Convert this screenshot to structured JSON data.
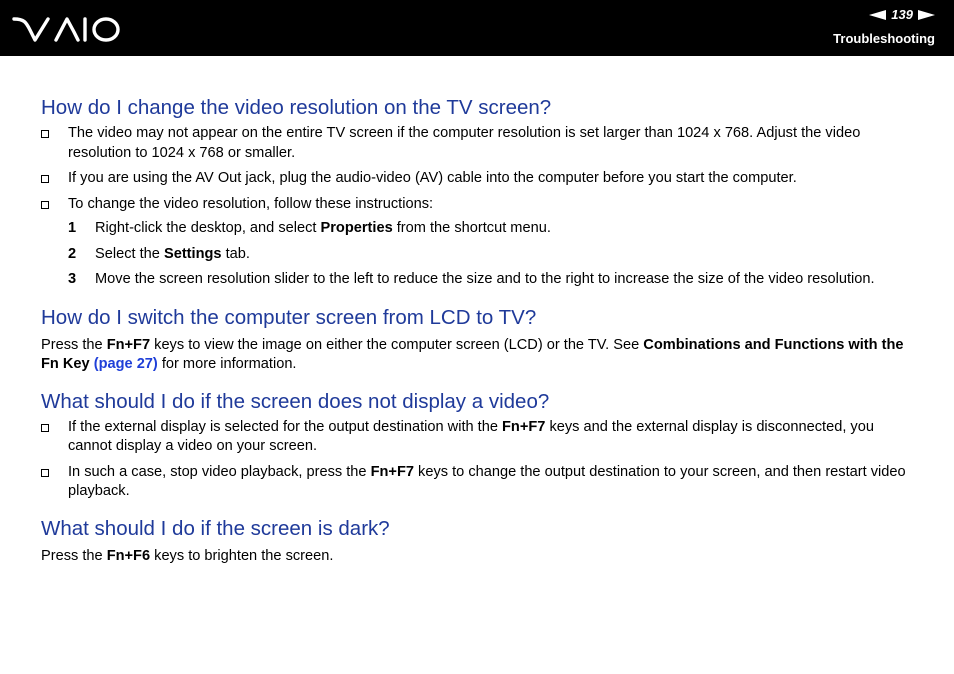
{
  "header": {
    "logo_icon": "vaio-logo",
    "page_number": "139",
    "section": "Troubleshooting"
  },
  "sections": [
    {
      "heading": "How do I change the video resolution on the TV screen?",
      "bullets": [
        "The video may not appear on the entire TV screen if the computer resolution is set larger than 1024 x 768. Adjust the video resolution to 1024 x 768 or smaller.",
        "If you are using the AV Out jack, plug the audio-video (AV) cable into the computer before you start the computer.",
        "To change the video resolution, follow these instructions:"
      ],
      "steps": [
        {
          "num": "1",
          "pre": "Right-click the desktop, and select ",
          "bold": "Properties",
          "post": " from the shortcut menu."
        },
        {
          "num": "2",
          "pre": "Select the ",
          "bold": "Settings",
          "post": " tab."
        },
        {
          "num": "3",
          "text": "Move the screen resolution slider to the left to reduce the size and to the right to increase the size of the video resolution."
        }
      ]
    },
    {
      "heading": "How do I switch the computer screen from LCD to TV?",
      "para": {
        "t1": "Press the ",
        "b1": "Fn+F7",
        "t2": " keys to view the image on either the computer screen (LCD) or the TV. See ",
        "b2": "Combinations and Functions with the Fn Key",
        "t3": " ",
        "link": "(page 27)",
        "t4": " for more information."
      }
    },
    {
      "heading": "What should I do if the screen does not display a video?",
      "bullets": [
        {
          "pre": "If the external display is selected for the output destination with the ",
          "bold": "Fn+F7",
          "post": " keys and the external display is disconnected, you cannot display a video on your screen."
        },
        {
          "pre": "In such a case, stop video playback, press the ",
          "bold": "Fn+F7",
          "post": " keys to change the output destination to your screen, and then restart video playback."
        }
      ]
    },
    {
      "heading": "What should I do if the screen is dark?",
      "para": {
        "t1": "Press the ",
        "b1": "Fn+F6",
        "t2": " keys to brighten the screen."
      }
    }
  ]
}
